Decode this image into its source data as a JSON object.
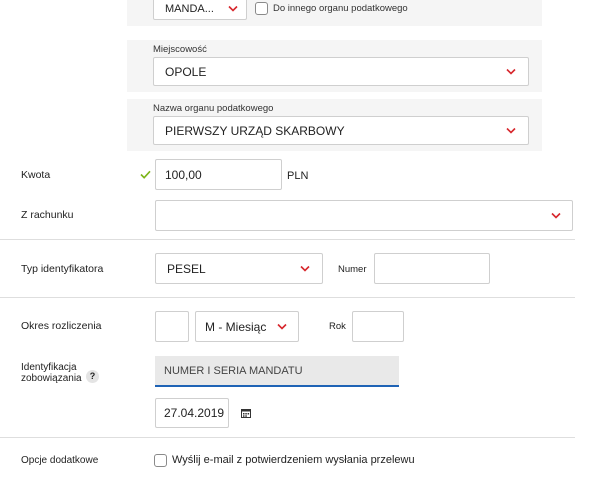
{
  "office": {
    "type_value": "MANDA...",
    "other_office_label": "Do innego organu podatkowego",
    "city_label": "Miejscowość",
    "city_value": "OPOLE",
    "office_name_label": "Nazwa organu podatkowego",
    "office_name_value": "PIERWSZY URZĄD SKARBOWY"
  },
  "amount": {
    "label": "Kwota",
    "value": "100,00",
    "currency": "PLN"
  },
  "account": {
    "label": "Z rachunku",
    "value": ""
  },
  "identifier": {
    "label": "Typ identyfikatora",
    "type_value": "PESEL",
    "number_label": "Numer",
    "number_value": ""
  },
  "period": {
    "label": "Okres rozliczenia",
    "day_value": "",
    "period_value": "M - Miesiąc",
    "year_label": "Rok",
    "year_value": ""
  },
  "obligation": {
    "label_line1": "Identyfikacja",
    "label_line2": "zobowiązania",
    "help_symbol": "?",
    "placeholder": "NUMER I SERIA MANDATU",
    "date_value": "27.04.2019"
  },
  "options": {
    "label": "Opcje dodatkowe",
    "email_checkbox_label": "Wyślij e-mail z potwierdzeniem wysłania przelewu"
  },
  "colors": {
    "accent_red": "#d7262c",
    "check_green": "#7cb518",
    "active_border": "#1f63b5"
  }
}
